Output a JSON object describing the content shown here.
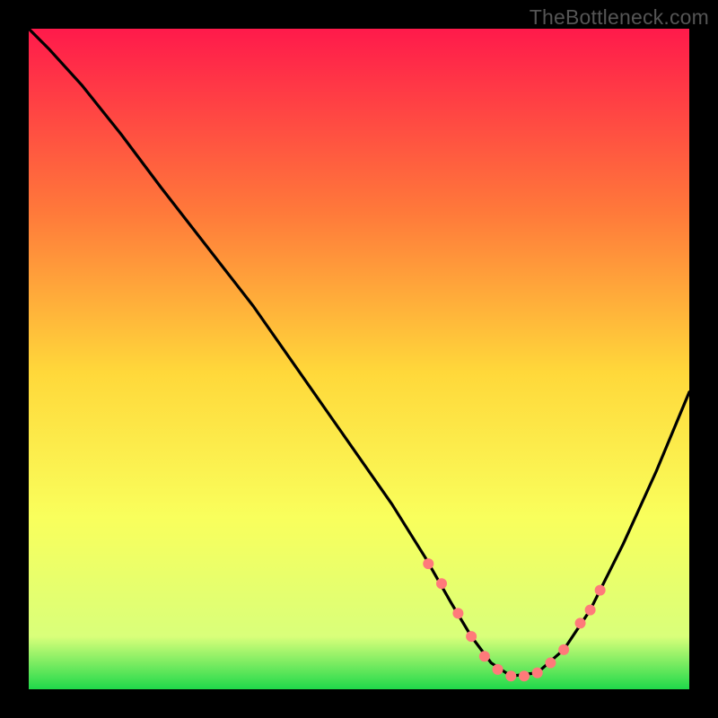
{
  "watermark": "TheBottleneck.com",
  "chart_data": {
    "type": "line",
    "title": "",
    "xlabel": "",
    "ylabel": "",
    "xlim": [
      0,
      100
    ],
    "ylim": [
      0,
      100
    ],
    "grid": false,
    "legend": false,
    "gradient_colors": {
      "top": "#ff1a4b",
      "upper_mid": "#ff7a3a",
      "mid": "#ffd83a",
      "lower_mid": "#f9ff5c",
      "low": "#d9ff7a",
      "bottom": "#1fd94a"
    },
    "curve_note": "V-shaped bottleneck curve: descends from top-left, minimum near x≈72, rises to right edge",
    "series": [
      {
        "name": "bottleneck-curve",
        "color": "#000000",
        "x": [
          0,
          3,
          8,
          14,
          20,
          27,
          34,
          41,
          48,
          55,
          60,
          64,
          67,
          70,
          73,
          77,
          81,
          85,
          90,
          95,
          100
        ],
        "y": [
          100,
          97,
          91.5,
          84,
          76,
          67,
          58,
          48,
          38,
          28,
          20,
          13,
          8,
          4,
          2,
          2.5,
          6,
          12,
          22,
          33,
          45
        ]
      }
    ],
    "markers": {
      "name": "highlight-dots",
      "color": "#ff7a7a",
      "radius": 6,
      "x": [
        60.5,
        62.5,
        65,
        67,
        69,
        71,
        73,
        75,
        77,
        79,
        81,
        83.5,
        85,
        86.5
      ],
      "y": [
        19,
        16,
        11.5,
        8,
        5,
        3,
        2,
        2,
        2.5,
        4,
        6,
        10,
        12,
        15
      ]
    }
  }
}
